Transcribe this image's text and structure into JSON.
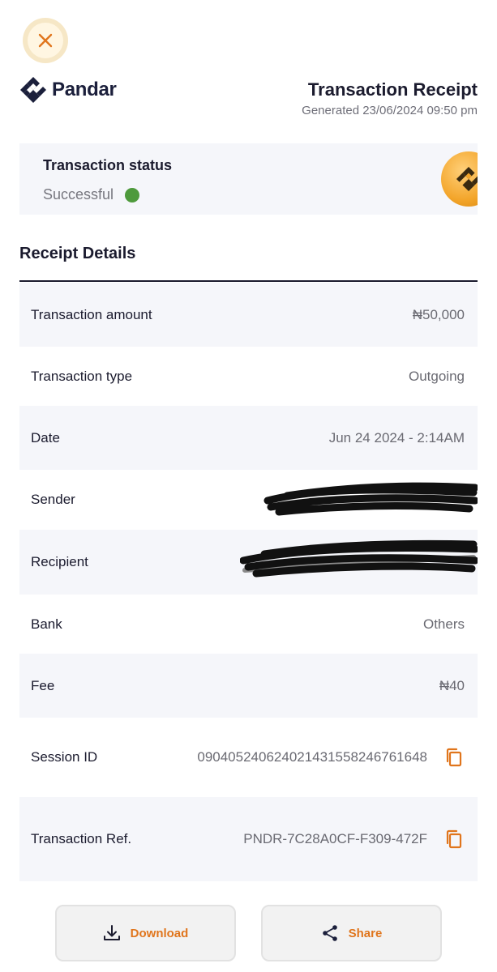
{
  "brand": {
    "name": "Pandar"
  },
  "header": {
    "title": "Transaction Receipt",
    "generated": "Generated 23/06/2024 09:50 pm"
  },
  "status": {
    "title": "Transaction status",
    "value": "Successful",
    "dot_color": "#4e9a3c"
  },
  "receipt": {
    "section_title": "Receipt Details",
    "rows": [
      {
        "label": "Transaction amount",
        "value": "₦50,000"
      },
      {
        "label": "Transaction type",
        "value": "Outgoing"
      },
      {
        "label": "Date",
        "value": "Jun 24 2024 - 2:14AM"
      },
      {
        "label": "Sender",
        "value": ""
      },
      {
        "label": "Recipient",
        "value": ""
      },
      {
        "label": "Bank",
        "value": "Others"
      },
      {
        "label": "Fee",
        "value": "₦40"
      },
      {
        "label": "Session ID",
        "value": "090405240624021431558246761648"
      },
      {
        "label": "Transaction Ref.",
        "value": "PNDR-7C28A0CF-F309-472F"
      }
    ]
  },
  "actions": {
    "download_label": "Download",
    "share_label": "Share"
  },
  "icons": {
    "close": "close-icon",
    "copy": "copy-icon",
    "download": "download-icon",
    "share": "share-icon"
  },
  "colors": {
    "accent": "#e0751c",
    "row_alt_bg": "#f5f6fa",
    "brand_dark": "#1b1f3b"
  }
}
